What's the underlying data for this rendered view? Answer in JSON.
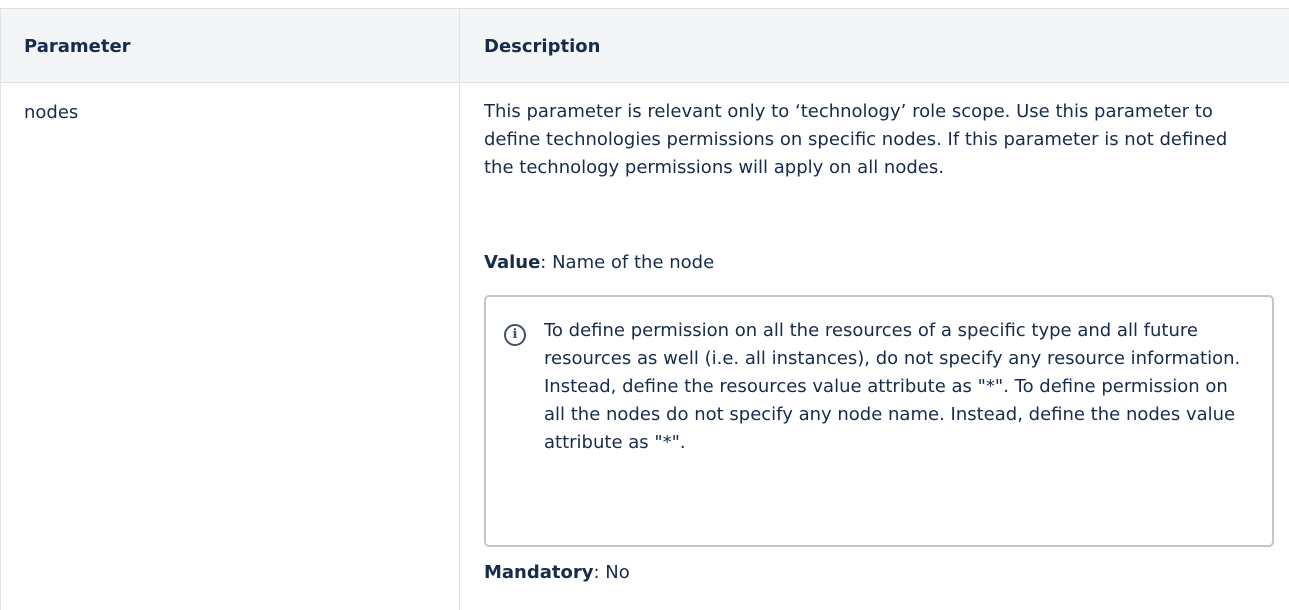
{
  "table": {
    "headers": {
      "parameter": "Parameter",
      "description": "Description"
    },
    "row": {
      "parameter": "nodes",
      "description": "This parameter is relevant only to ‘technology’ role scope. Use this parameter to define technologies permissions on specific nodes. If this parameter is not defined the technology permissions will apply on all nodes.",
      "value_label": "Value",
      "value_text": ": Name of the node",
      "info_panel": {
        "icon": "info-icon",
        "icon_glyph": "i",
        "text": "To define permission on all the resources of a specific type and all future resources as well (i.e. all instances), do not specify any resource information. Instead, define the resources value attribute as \"*\". To define permission on all the nodes do not specify any node name. Instead, define the nodes value attribute as \"*\"."
      },
      "mandatory_label": "Mandatory",
      "mandatory_text": ": No"
    }
  },
  "colors": {
    "text": "#172b4d",
    "header_bg": "#f4f5f7",
    "border": "#dfe1e6",
    "panel_border": "#c1c7d0",
    "icon": "#42526e"
  }
}
